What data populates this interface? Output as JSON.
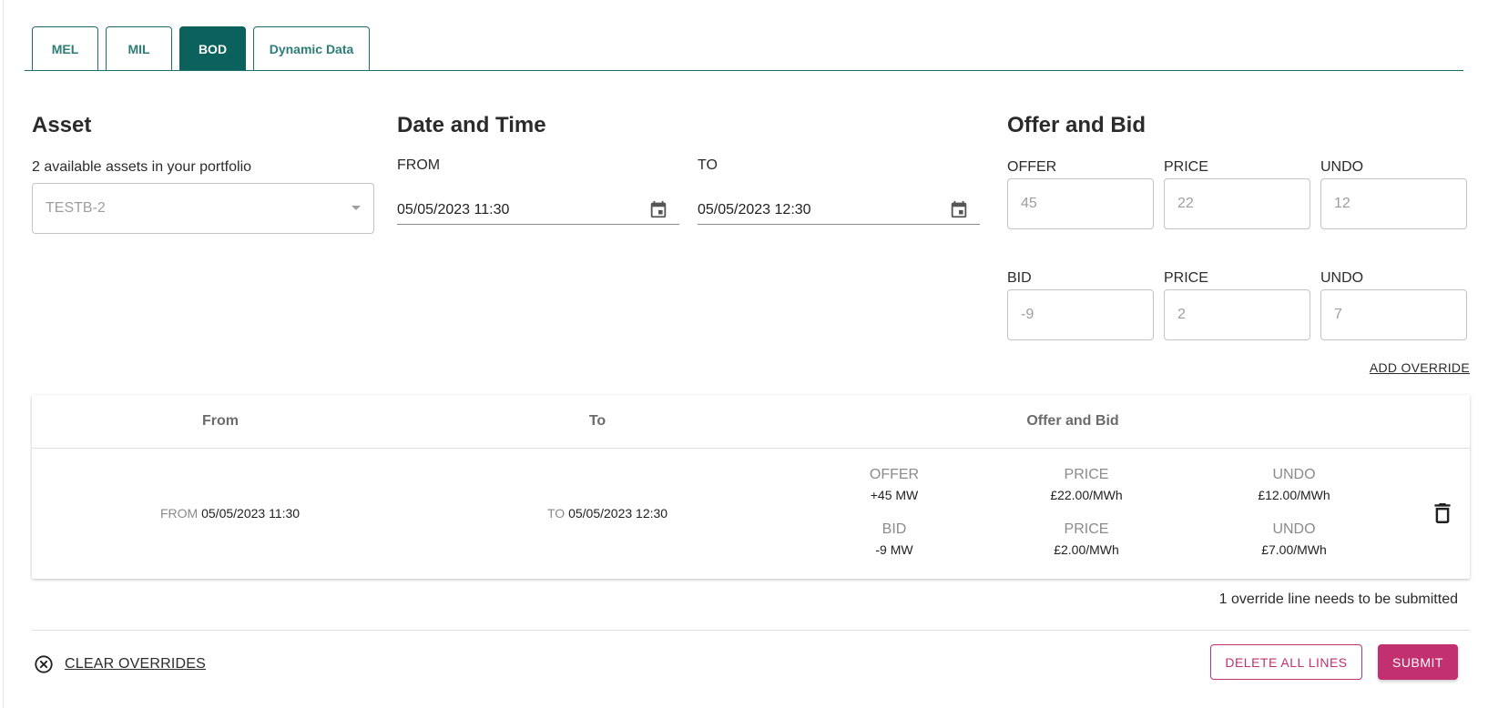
{
  "tabs": [
    {
      "label": "MEL"
    },
    {
      "label": "MIL"
    },
    {
      "label": "BOD",
      "active": true
    },
    {
      "label": "Dynamic Data"
    }
  ],
  "asset": {
    "heading": "Asset",
    "hint": "2 available assets in your portfolio",
    "selected": "TESTB-2"
  },
  "datetime": {
    "heading": "Date and Time",
    "from_label": "FROM",
    "from_value": "05/05/2023 11:30",
    "to_label": "TO",
    "to_value": "05/05/2023 12:30"
  },
  "offer_bid": {
    "heading": "Offer and Bid",
    "offer_label": "OFFER",
    "offer_placeholder": "45",
    "offer_price_label": "PRICE",
    "offer_price_placeholder": "22",
    "offer_undo_label": "UNDO",
    "offer_undo_placeholder": "12",
    "bid_label": "BID",
    "bid_placeholder": "-9",
    "bid_price_label": "PRICE",
    "bid_price_placeholder": "2",
    "bid_undo_label": "UNDO",
    "bid_undo_placeholder": "7",
    "add_override": "ADD OVERRIDE"
  },
  "table": {
    "headers": {
      "from": "From",
      "to": "To",
      "offer_bid": "Offer and Bid"
    },
    "row": {
      "from_prefix": "FROM",
      "from_value": "05/05/2023 11:30",
      "to_prefix": "TO",
      "to_value": "05/05/2023 12:30",
      "offer_cap": "OFFER",
      "offer_val": "+45 MW",
      "offer_price_cap": "PRICE",
      "offer_price_val": "£22.00/MWh",
      "offer_undo_cap": "UNDO",
      "offer_undo_val": "£12.00/MWh",
      "bid_cap": "BID",
      "bid_val": "-9 MW",
      "bid_price_cap": "PRICE",
      "bid_price_val": "£2.00/MWh",
      "bid_undo_cap": "UNDO",
      "bid_undo_val": "£7.00/MWh"
    }
  },
  "footer": {
    "pending": "1 override line needs to be submitted",
    "clear": "CLEAR OVERRIDES",
    "delete_all": "DELETE ALL LINES",
    "submit": "SUBMIT"
  },
  "icons": {
    "calendar": "calendar-icon",
    "trash": "trash-icon",
    "clear": "close-circle-icon",
    "caret": "caret-down-icon"
  },
  "colors": {
    "teal": "#0b615c",
    "accent_pink": "#c2306f"
  }
}
